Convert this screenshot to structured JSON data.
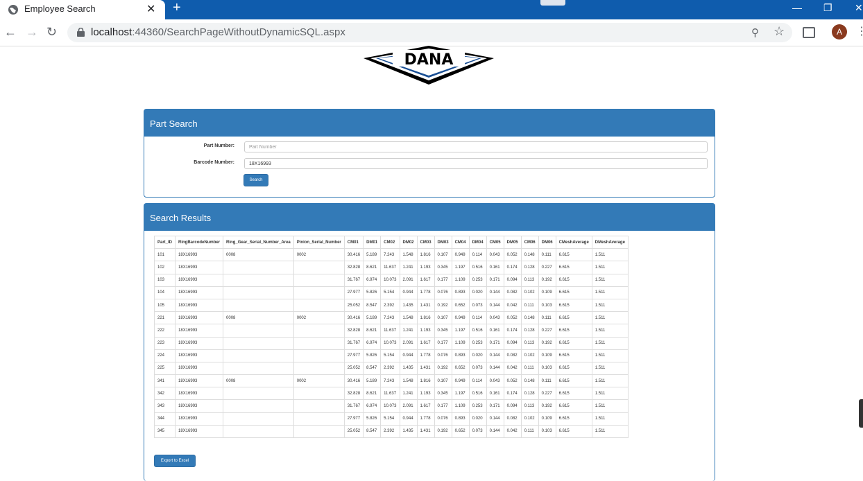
{
  "browser": {
    "tab_title": "Employee Search",
    "tab_close": "✕",
    "new_tab": "+",
    "url_host": "localhost",
    "url_path": ":44360/SearchPageWithoutDynamicSQL.aspx",
    "avatar_letter": "A",
    "controls": {
      "minimize": "—",
      "maximize": "❐",
      "close": "✕"
    }
  },
  "logo": {
    "text": "DANA"
  },
  "search_panel": {
    "title": "Part Search",
    "part_number_label": "Part Number:",
    "part_number_placeholder": "Part Number",
    "part_number_value": "",
    "barcode_label": "Barcode Number:",
    "barcode_value": "18X16993",
    "search_button": "Search"
  },
  "results_panel": {
    "title": "Search Results",
    "export_button": "Export to Excel",
    "columns": [
      "Part_ID",
      "RingBarcodeNumber",
      "Ring_Gear_Serial_Number_Area",
      "Pinion_Serial_Number",
      "CM01",
      "DM01",
      "CM02",
      "DM02",
      "CM03",
      "DM03",
      "CM04",
      "DM04",
      "CM05",
      "DM05",
      "CM06",
      "DM06",
      "CMeshAverage",
      "DMeshAverage"
    ],
    "rows": [
      [
        "101",
        "18X16993",
        "0008",
        "0002",
        "30.416",
        "5.189",
        "7.243",
        "1.548",
        "1.816",
        "0.107",
        "0.949",
        "0.114",
        "0.043",
        "0.052",
        "0.148",
        "0.111",
        "6.615",
        "1.511"
      ],
      [
        "102",
        "18X16993",
        "",
        "",
        "32.828",
        "8.621",
        "11.637",
        "1.241",
        "1.193",
        "0.345",
        "1.197",
        "0.516",
        "0.161",
        "0.174",
        "0.128",
        "0.227",
        "6.615",
        "1.511"
      ],
      [
        "103",
        "18X16993",
        "",
        "",
        "31.767",
        "6.974",
        "10.073",
        "2.091",
        "1.617",
        "0.177",
        "1.109",
        "0.253",
        "0.171",
        "0.094",
        "0.113",
        "0.192",
        "6.615",
        "1.511"
      ],
      [
        "104",
        "18X16993",
        "",
        "",
        "27.977",
        "5.826",
        "5.154",
        "0.944",
        "1.778",
        "0.076",
        "0.893",
        "0.020",
        "0.144",
        "0.082",
        "0.102",
        "0.109",
        "6.615",
        "1.511"
      ],
      [
        "105",
        "18X16993",
        "",
        "",
        "25.052",
        "8.547",
        "2.392",
        "1.435",
        "1.431",
        "0.192",
        "0.652",
        "0.073",
        "0.144",
        "0.042",
        "0.111",
        "0.103",
        "6.615",
        "1.511"
      ],
      [
        "221",
        "18X16993",
        "0008",
        "0002",
        "30.416",
        "5.189",
        "7.243",
        "1.548",
        "1.816",
        "0.107",
        "0.949",
        "0.114",
        "0.043",
        "0.052",
        "0.148",
        "0.111",
        "6.615",
        "1.511"
      ],
      [
        "222",
        "18X16993",
        "",
        "",
        "32.828",
        "8.621",
        "11.637",
        "1.241",
        "1.193",
        "0.345",
        "1.197",
        "0.516",
        "0.161",
        "0.174",
        "0.128",
        "0.227",
        "6.615",
        "1.511"
      ],
      [
        "223",
        "18X16993",
        "",
        "",
        "31.767",
        "6.974",
        "10.073",
        "2.091",
        "1.617",
        "0.177",
        "1.109",
        "0.253",
        "0.171",
        "0.094",
        "0.113",
        "0.192",
        "6.615",
        "1.511"
      ],
      [
        "224",
        "18X16993",
        "",
        "",
        "27.977",
        "5.826",
        "5.154",
        "0.944",
        "1.778",
        "0.076",
        "0.893",
        "0.020",
        "0.144",
        "0.082",
        "0.102",
        "0.109",
        "6.615",
        "1.511"
      ],
      [
        "225",
        "18X16993",
        "",
        "",
        "25.052",
        "8.547",
        "2.392",
        "1.435",
        "1.431",
        "0.192",
        "0.652",
        "0.073",
        "0.144",
        "0.042",
        "0.111",
        "0.103",
        "6.615",
        "1.511"
      ],
      [
        "341",
        "18X16993",
        "0008",
        "0002",
        "30.416",
        "5.189",
        "7.243",
        "1.548",
        "1.816",
        "0.107",
        "0.949",
        "0.114",
        "0.043",
        "0.052",
        "0.148",
        "0.111",
        "6.615",
        "1.511"
      ],
      [
        "342",
        "18X16993",
        "",
        "",
        "32.828",
        "8.621",
        "11.637",
        "1.241",
        "1.193",
        "0.345",
        "1.197",
        "0.516",
        "0.161",
        "0.174",
        "0.128",
        "0.227",
        "6.615",
        "1.511"
      ],
      [
        "343",
        "18X16993",
        "",
        "",
        "31.767",
        "6.974",
        "10.073",
        "2.091",
        "1.617",
        "0.177",
        "1.109",
        "0.253",
        "0.171",
        "0.094",
        "0.113",
        "0.192",
        "6.615",
        "1.511"
      ],
      [
        "344",
        "18X16993",
        "",
        "",
        "27.977",
        "5.826",
        "5.154",
        "0.944",
        "1.778",
        "0.076",
        "0.893",
        "0.020",
        "0.144",
        "0.082",
        "0.102",
        "0.109",
        "6.615",
        "1.511"
      ],
      [
        "345",
        "18X16993",
        "",
        "",
        "25.052",
        "8.547",
        "2.392",
        "1.435",
        "1.431",
        "0.192",
        "0.652",
        "0.073",
        "0.144",
        "0.042",
        "0.111",
        "0.103",
        "6.615",
        "1.511"
      ]
    ]
  },
  "colors": {
    "primary": "#337ab7",
    "chrome_blue": "#0f5cad"
  }
}
